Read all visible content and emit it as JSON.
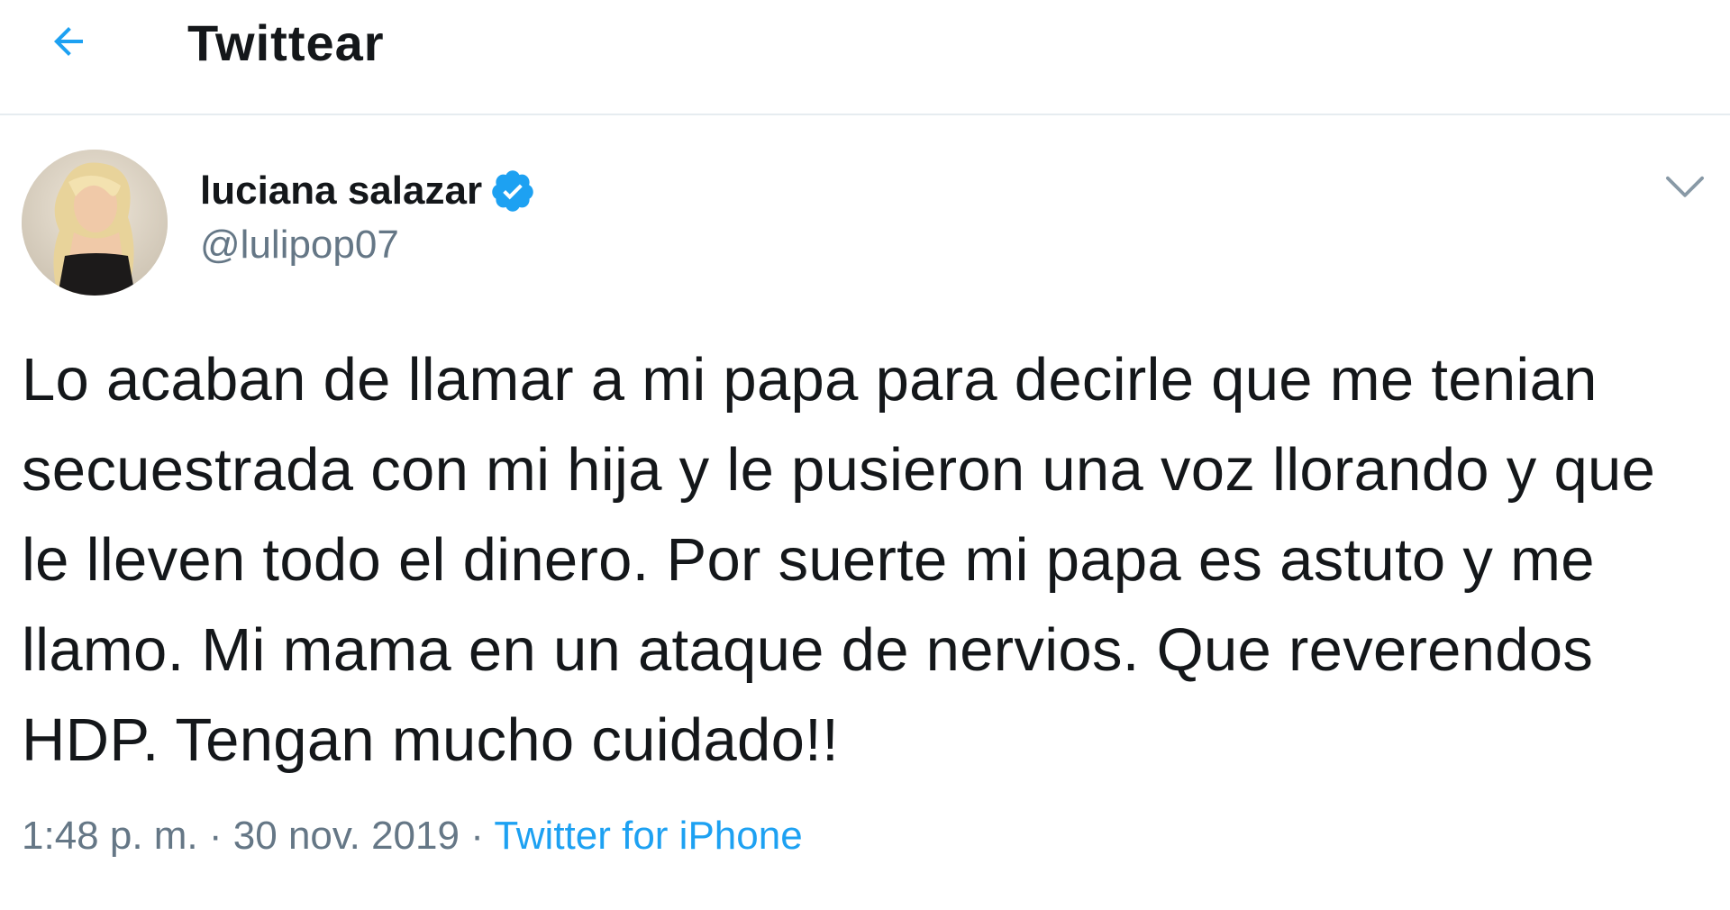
{
  "header": {
    "title": "Twittear",
    "back_icon": "arrow-left-icon"
  },
  "tweet": {
    "display_name": "luciana salazar",
    "handle": "@lulipop07",
    "verified": true,
    "text": "Lo acaban de llamar a mi papa para decirle que me tenian secuestrada con mi hija y le pusieron una voz llorando y que le lleven todo el dinero. Por suerte mi papa es astuto y me llamo. Mi mama en un ataque de nervios. Que reverendos HDP. Tengan mucho cuidado!!",
    "time": "1:48 p. m.",
    "separator": "·",
    "date": "30 nov. 2019",
    "source": "Twitter for iPhone"
  },
  "colors": {
    "accent": "#1da1f2",
    "text_primary": "#14171a",
    "text_secondary": "#657786",
    "divider": "#e6ecf0"
  }
}
